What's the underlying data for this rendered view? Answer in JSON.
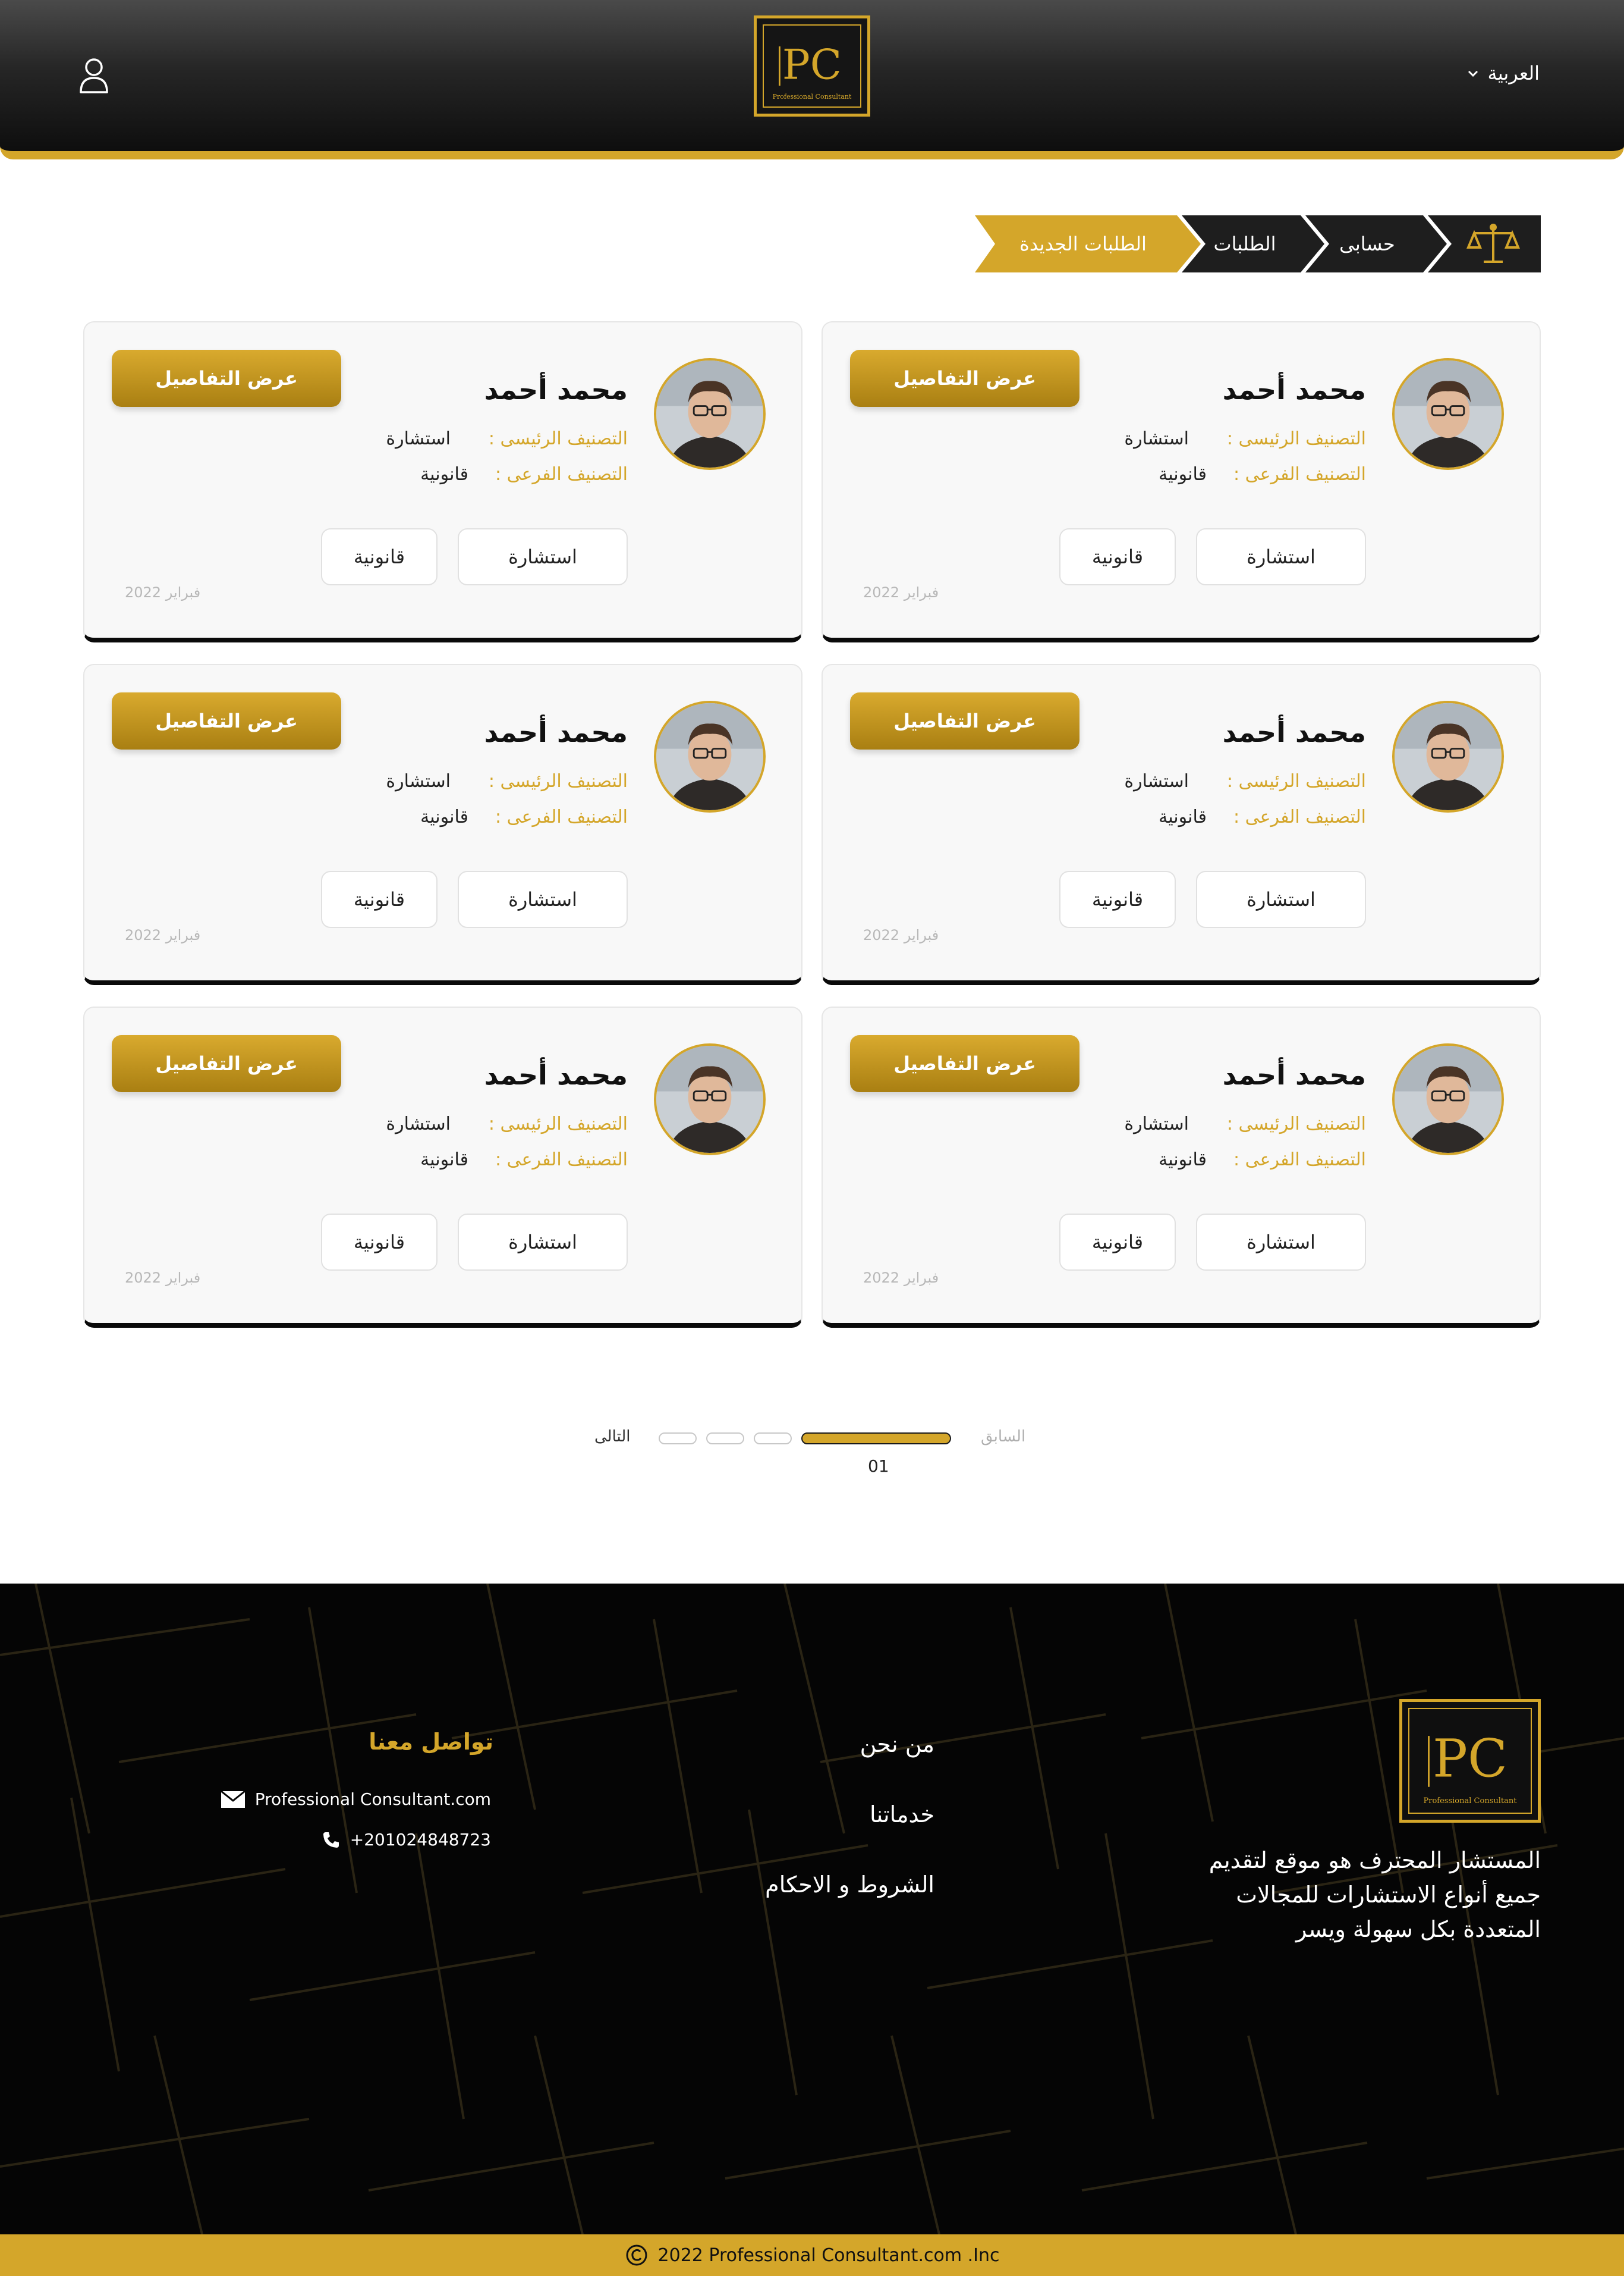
{
  "header": {
    "language": "العربية",
    "logo_tagline": "Professional Consultant"
  },
  "breadcrumb": {
    "items": [
      "حسابى",
      "الطلبات",
      "الطلبات الجديدة"
    ]
  },
  "cards": [
    {
      "name": "محمد أحمد",
      "main_label": "التصنيف الرئيسى :",
      "main_value": "استشارة",
      "sub_label": "التصنيف الفرعى :",
      "sub_value": "قانونية",
      "tags": [
        "استشارة",
        "قانونية"
      ],
      "date": "فبراير 2022",
      "details_label": "عرض التفاصيل"
    },
    {
      "name": "محمد أحمد",
      "main_label": "التصنيف الرئيسى :",
      "main_value": "استشارة",
      "sub_label": "التصنيف الفرعى :",
      "sub_value": "قانونية",
      "tags": [
        "استشارة",
        "قانونية"
      ],
      "date": "فبراير 2022",
      "details_label": "عرض التفاصيل"
    },
    {
      "name": "محمد أحمد",
      "main_label": "التصنيف الرئيسى :",
      "main_value": "استشارة",
      "sub_label": "التصنيف الفرعى :",
      "sub_value": "قانونية",
      "tags": [
        "استشارة",
        "قانونية"
      ],
      "date": "فبراير 2022",
      "details_label": "عرض التفاصيل"
    },
    {
      "name": "محمد أحمد",
      "main_label": "التصنيف الرئيسى :",
      "main_value": "استشارة",
      "sub_label": "التصنيف الفرعى :",
      "sub_value": "قانونية",
      "tags": [
        "استشارة",
        "قانونية"
      ],
      "date": "فبراير 2022",
      "details_label": "عرض التفاصيل"
    },
    {
      "name": "محمد أحمد",
      "main_label": "التصنيف الرئيسى :",
      "main_value": "استشارة",
      "sub_label": "التصنيف الفرعى :",
      "sub_value": "قانونية",
      "tags": [
        "استشارة",
        "قانونية"
      ],
      "date": "فبراير 2022",
      "details_label": "عرض التفاصيل"
    },
    {
      "name": "محمد أحمد",
      "main_label": "التصنيف الرئيسى :",
      "main_value": "استشارة",
      "sub_label": "التصنيف الفرعى :",
      "sub_value": "قانونية",
      "tags": [
        "استشارة",
        "قانونية"
      ],
      "date": "فبراير 2022",
      "details_label": "عرض التفاصيل"
    }
  ],
  "pagination": {
    "prev_label": "السابق",
    "next_label": "التالى",
    "current_page": "01"
  },
  "footer": {
    "about": "المستشار المحترف هو موقع لتقديم جميع أنواع الاستشارات للمجالات المتعددة بكل سهولة ويسر",
    "links": [
      "من نحن",
      "خدماتنا",
      "الشروط و الاحكام"
    ],
    "contact_title": "تواصل معنا",
    "email": "Professional Consultant.com",
    "phone": "+201024848723",
    "copyright": "2022  Professional Consultant.com  .Inc"
  },
  "colors": {
    "accent": "#d4a62a",
    "dark": "#0a0a0a"
  }
}
